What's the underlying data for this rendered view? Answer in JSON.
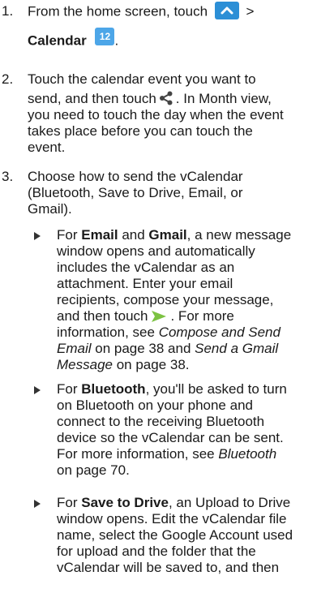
{
  "steps": [
    {
      "num": "1.",
      "lines": {
        "l1": "From the home screen, touch",
        "l1b": ">",
        "l2": "Calendar",
        "l2b": "."
      },
      "icons": {
        "apps": "chevron-up-icon",
        "calendar": "calendar-icon",
        "calendar_day": "12"
      }
    },
    {
      "num": "2.",
      "lines": {
        "l1": "Touch the calendar event you want to",
        "l2a": "send, and then touch",
        "l2b": ". In Month view,",
        "l3": "you need to touch the day when the event",
        "l4": "takes place before you can touch the",
        "l5": "event."
      },
      "icons": {
        "share": "share-icon"
      }
    },
    {
      "num": "3.",
      "lines": {
        "l1": "Choose how to send the vCalendar",
        "l2": "(Bluetooth, Save to Drive, Email, or",
        "l3": "Gmail)."
      }
    }
  ],
  "bullets": [
    {
      "l1a": "For ",
      "l1b": "Email",
      "l1c": " and ",
      "l1d": "Gmail",
      "l1e": ", a new message",
      "l2": "window opens and automatically",
      "l3": "includes the vCalendar as an",
      "l4": "attachment. Enter your email",
      "l5": "recipients, compose your message,",
      "l6a": "and then touch",
      "l6b": ". For more",
      "l7a": "information, see ",
      "l7b": "Compose and Send",
      "l8a": "Email",
      "l8b": " on page 38 and ",
      "l8c": "Send a Gmail",
      "l9a": "Message",
      "l9b": " on page 38.",
      "send_icon": "send-icon"
    },
    {
      "l1a": "For ",
      "l1b": "Bluetooth",
      "l1c": ", you'll be asked to turn",
      "l2": "on Bluetooth on your phone and",
      "l3": "connect to the receiving Bluetooth",
      "l4": "device so the vCalendar can be sent.",
      "l5": "For more information, see ",
      "l5b": "Bluetooth",
      "l6": "on page 70."
    },
    {
      "l1a": "For ",
      "l1b": "Save to Drive",
      "l1c": ", an Upload to Drive",
      "l2": "window opens. Edit the vCalendar file",
      "l3": "name, select the Google Account used",
      "l4": "for upload and the folder that the",
      "l5": "vCalendar will be saved to, and then"
    }
  ]
}
